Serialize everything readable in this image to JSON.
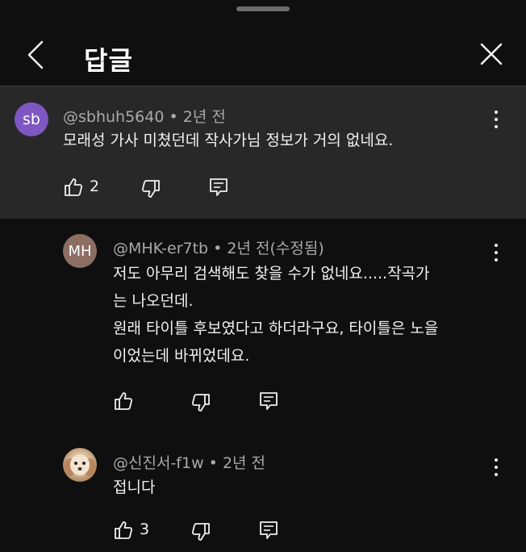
{
  "header": {
    "title": "답글"
  },
  "parent": {
    "avatar_initials": "sb",
    "handle": "@sbhuh5640",
    "time": "2년 전",
    "text": "모래성 가사 미쳤던데 작사가님 정보가 거의 없네요.",
    "like_count": "2"
  },
  "replies": [
    {
      "avatar_initials": "MH",
      "handle": "@MHK-er7tb",
      "time": "2년 전(수정됨)",
      "lines": [
        "저도 아무리 검색해도 찾을 수가 없네요.....작곡가",
        "는 나오던데.",
        "원래 타이틀 후보였다고 하더라구요, 타이틀은 노을",
        "이었는데 바뀌었데요."
      ],
      "like_count": ""
    },
    {
      "handle": "@신진서-f1w",
      "time": "2년 전",
      "lines": [
        "접니다"
      ],
      "like_count": "3"
    }
  ],
  "colors": {
    "background": "#0f0f0f",
    "highlight": "#282828",
    "meta": "#aaaaaa",
    "avatar_sb": "#7e57c2",
    "avatar_mh": "#8d6e63"
  },
  "icons": [
    "chevron-left-icon",
    "close-icon",
    "more-vert-icon",
    "thumb-up-icon",
    "thumb-down-icon",
    "reply-icon"
  ]
}
